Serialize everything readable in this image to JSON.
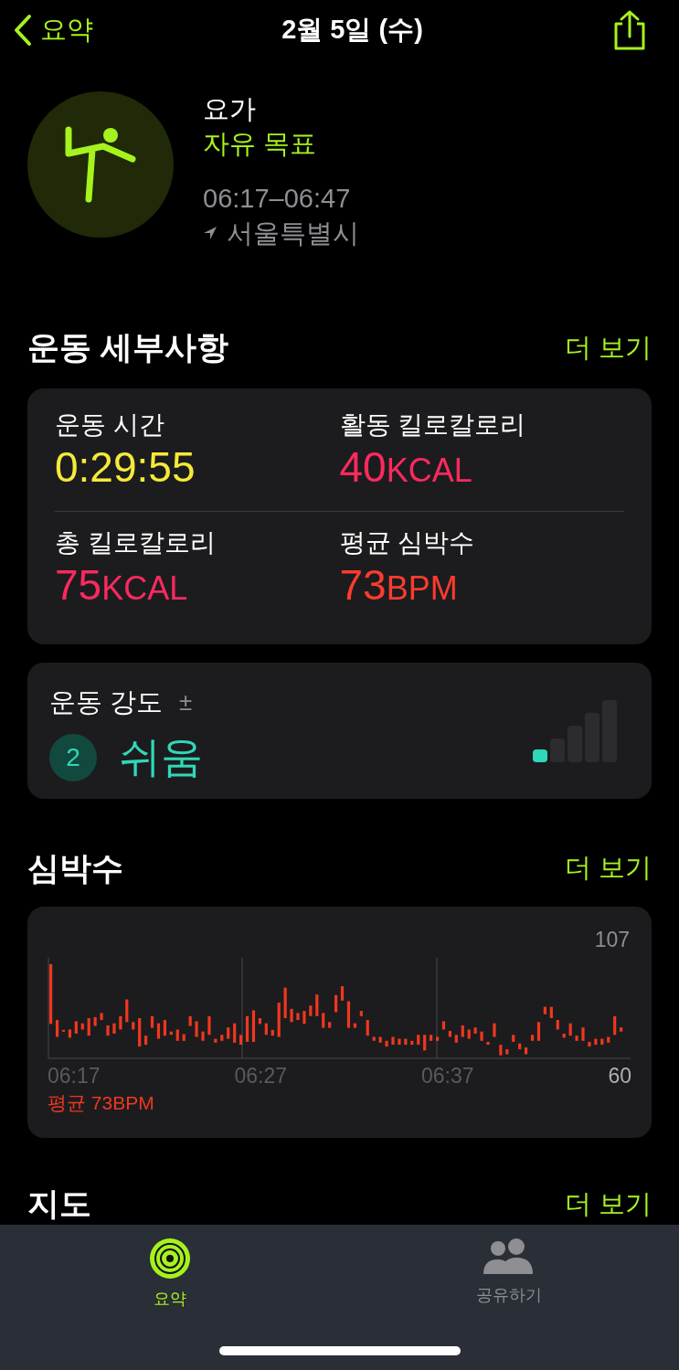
{
  "nav": {
    "back": "요약",
    "title": "2월 5일 (수)"
  },
  "workout": {
    "name": "요가",
    "goal": "자유 목표",
    "time": "06:17–06:47",
    "location": "서울특별시"
  },
  "details": {
    "title": "운동 세부사항",
    "more": "더 보기",
    "metrics": [
      {
        "label": "운동 시간",
        "value": "0:29:55",
        "color": "#f6e93a"
      },
      {
        "label": "활동 킬로칼로리",
        "value": "40",
        "unit": "KCAL",
        "color": "#fa2a5e"
      },
      {
        "label": "총 킬로칼로리",
        "value": "75",
        "unit": "KCAL",
        "color": "#fa2a5e"
      },
      {
        "label": "평균 심박수",
        "value": "73",
        "unit": "BPM",
        "color": "#fd3c2e"
      }
    ]
  },
  "intensity": {
    "label": "운동 강도",
    "adjust": "±",
    "number": "2",
    "text": "쉬움",
    "level": 0.2
  },
  "heart_rate": {
    "title": "심박수",
    "more": "더 보기",
    "max": "107",
    "min": "60",
    "times": [
      "06:17",
      "06:27",
      "06:37"
    ],
    "average": "평균 73BPM"
  },
  "map": {
    "title": "지도",
    "more": "더 보기"
  },
  "tabs": [
    {
      "label": "요약",
      "selected": true,
      "kind": "rings"
    },
    {
      "label": "공유하기",
      "selected": false,
      "kind": "people"
    }
  ]
}
